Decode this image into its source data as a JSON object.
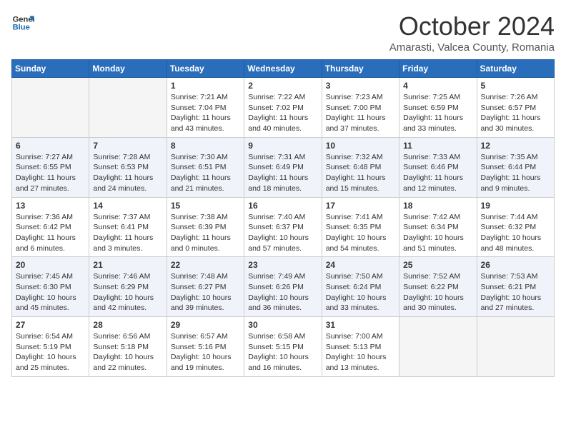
{
  "header": {
    "logo_line1": "General",
    "logo_line2": "Blue",
    "month": "October 2024",
    "location": "Amarasti, Valcea County, Romania"
  },
  "days_of_week": [
    "Sunday",
    "Monday",
    "Tuesday",
    "Wednesday",
    "Thursday",
    "Friday",
    "Saturday"
  ],
  "weeks": [
    [
      {
        "day": "",
        "info": ""
      },
      {
        "day": "",
        "info": ""
      },
      {
        "day": "1",
        "info": "Sunrise: 7:21 AM\nSunset: 7:04 PM\nDaylight: 11 hours and 43 minutes."
      },
      {
        "day": "2",
        "info": "Sunrise: 7:22 AM\nSunset: 7:02 PM\nDaylight: 11 hours and 40 minutes."
      },
      {
        "day": "3",
        "info": "Sunrise: 7:23 AM\nSunset: 7:00 PM\nDaylight: 11 hours and 37 minutes."
      },
      {
        "day": "4",
        "info": "Sunrise: 7:25 AM\nSunset: 6:59 PM\nDaylight: 11 hours and 33 minutes."
      },
      {
        "day": "5",
        "info": "Sunrise: 7:26 AM\nSunset: 6:57 PM\nDaylight: 11 hours and 30 minutes."
      }
    ],
    [
      {
        "day": "6",
        "info": "Sunrise: 7:27 AM\nSunset: 6:55 PM\nDaylight: 11 hours and 27 minutes."
      },
      {
        "day": "7",
        "info": "Sunrise: 7:28 AM\nSunset: 6:53 PM\nDaylight: 11 hours and 24 minutes."
      },
      {
        "day": "8",
        "info": "Sunrise: 7:30 AM\nSunset: 6:51 PM\nDaylight: 11 hours and 21 minutes."
      },
      {
        "day": "9",
        "info": "Sunrise: 7:31 AM\nSunset: 6:49 PM\nDaylight: 11 hours and 18 minutes."
      },
      {
        "day": "10",
        "info": "Sunrise: 7:32 AM\nSunset: 6:48 PM\nDaylight: 11 hours and 15 minutes."
      },
      {
        "day": "11",
        "info": "Sunrise: 7:33 AM\nSunset: 6:46 PM\nDaylight: 11 hours and 12 minutes."
      },
      {
        "day": "12",
        "info": "Sunrise: 7:35 AM\nSunset: 6:44 PM\nDaylight: 11 hours and 9 minutes."
      }
    ],
    [
      {
        "day": "13",
        "info": "Sunrise: 7:36 AM\nSunset: 6:42 PM\nDaylight: 11 hours and 6 minutes."
      },
      {
        "day": "14",
        "info": "Sunrise: 7:37 AM\nSunset: 6:41 PM\nDaylight: 11 hours and 3 minutes."
      },
      {
        "day": "15",
        "info": "Sunrise: 7:38 AM\nSunset: 6:39 PM\nDaylight: 11 hours and 0 minutes."
      },
      {
        "day": "16",
        "info": "Sunrise: 7:40 AM\nSunset: 6:37 PM\nDaylight: 10 hours and 57 minutes."
      },
      {
        "day": "17",
        "info": "Sunrise: 7:41 AM\nSunset: 6:35 PM\nDaylight: 10 hours and 54 minutes."
      },
      {
        "day": "18",
        "info": "Sunrise: 7:42 AM\nSunset: 6:34 PM\nDaylight: 10 hours and 51 minutes."
      },
      {
        "day": "19",
        "info": "Sunrise: 7:44 AM\nSunset: 6:32 PM\nDaylight: 10 hours and 48 minutes."
      }
    ],
    [
      {
        "day": "20",
        "info": "Sunrise: 7:45 AM\nSunset: 6:30 PM\nDaylight: 10 hours and 45 minutes."
      },
      {
        "day": "21",
        "info": "Sunrise: 7:46 AM\nSunset: 6:29 PM\nDaylight: 10 hours and 42 minutes."
      },
      {
        "day": "22",
        "info": "Sunrise: 7:48 AM\nSunset: 6:27 PM\nDaylight: 10 hours and 39 minutes."
      },
      {
        "day": "23",
        "info": "Sunrise: 7:49 AM\nSunset: 6:26 PM\nDaylight: 10 hours and 36 minutes."
      },
      {
        "day": "24",
        "info": "Sunrise: 7:50 AM\nSunset: 6:24 PM\nDaylight: 10 hours and 33 minutes."
      },
      {
        "day": "25",
        "info": "Sunrise: 7:52 AM\nSunset: 6:22 PM\nDaylight: 10 hours and 30 minutes."
      },
      {
        "day": "26",
        "info": "Sunrise: 7:53 AM\nSunset: 6:21 PM\nDaylight: 10 hours and 27 minutes."
      }
    ],
    [
      {
        "day": "27",
        "info": "Sunrise: 6:54 AM\nSunset: 5:19 PM\nDaylight: 10 hours and 25 minutes."
      },
      {
        "day": "28",
        "info": "Sunrise: 6:56 AM\nSunset: 5:18 PM\nDaylight: 10 hours and 22 minutes."
      },
      {
        "day": "29",
        "info": "Sunrise: 6:57 AM\nSunset: 5:16 PM\nDaylight: 10 hours and 19 minutes."
      },
      {
        "day": "30",
        "info": "Sunrise: 6:58 AM\nSunset: 5:15 PM\nDaylight: 10 hours and 16 minutes."
      },
      {
        "day": "31",
        "info": "Sunrise: 7:00 AM\nSunset: 5:13 PM\nDaylight: 10 hours and 13 minutes."
      },
      {
        "day": "",
        "info": ""
      },
      {
        "day": "",
        "info": ""
      }
    ]
  ]
}
